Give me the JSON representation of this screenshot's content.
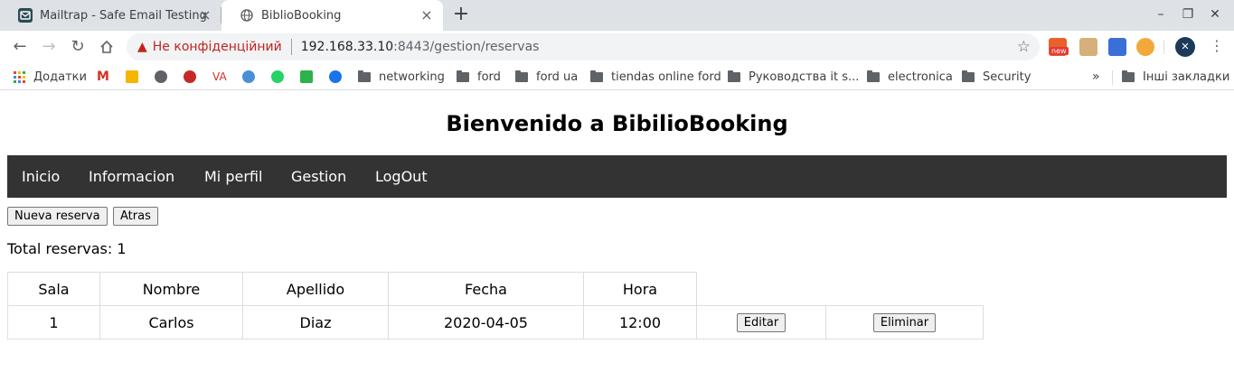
{
  "browser": {
    "tabs": [
      {
        "title": "Mailtrap - Safe Email Testing",
        "active": false,
        "icon": "mailtrap-icon"
      },
      {
        "title": "BiblioBooking",
        "active": true,
        "icon": "globe-icon"
      }
    ],
    "omnibox": {
      "security_label": "Не конфіденційний",
      "host": "192.168.33.10",
      "rest": ":8443/gestion/reservas"
    },
    "extensions": {
      "new_badge": "new"
    },
    "bookmarks": {
      "apps_label": "Додатки",
      "items": [
        "networking",
        "ford",
        "ford ua",
        "tiendas online ford",
        "Руководства it s...",
        "electronica",
        "Security"
      ],
      "other_label": "Інші закладки"
    }
  },
  "page": {
    "title": "Bienvenido a BibilioBooking",
    "nav": [
      "Inicio",
      "Informacion",
      "Mi perfil",
      "Gestion",
      "LogOut"
    ],
    "buttons": {
      "new_reservation": "Nueva reserva",
      "back": "Atras"
    },
    "total_text": "Total reservas: 1",
    "table": {
      "headers": [
        "Sala",
        "Nombre",
        "Apellido",
        "Fecha",
        "Hora"
      ],
      "rows": [
        {
          "sala": "1",
          "nombre": "Carlos",
          "apellido": "Diaz",
          "fecha": "2020-04-05",
          "hora": "12:00",
          "edit": "Editar",
          "delete": "Eliminar"
        }
      ]
    }
  },
  "colors": {
    "navbar": "#333333",
    "warning": "#c5221f",
    "tabstrip": "#dee1e6"
  }
}
